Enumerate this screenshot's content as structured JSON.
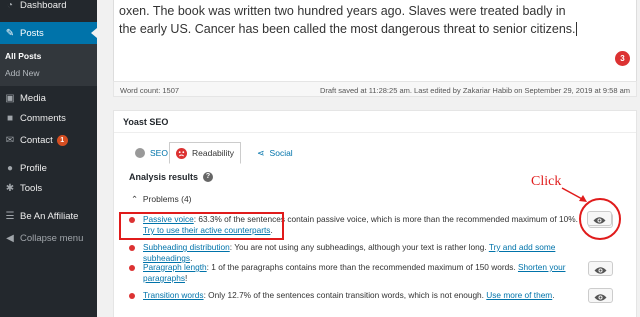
{
  "sidebar": {
    "dashboard": "Dashboard",
    "posts": "Posts",
    "all_posts": "All Posts",
    "add_new": "Add New",
    "media": "Media",
    "comments": "Comments",
    "contact": "Contact",
    "contact_badge": "1",
    "profile": "Profile",
    "tools": "Tools",
    "be_affiliate": "Be An Affiliate",
    "collapse": "Collapse menu"
  },
  "editor": {
    "text": "oxen. The book was written two hundred years ago. Slaves were treated badly in the early US. Cancer has been called the most dangerous threat to senior citizens.",
    "error_count": "3",
    "word_count": "Word count: 1507",
    "draft_info": "Draft saved at 11:28:25 am. Last edited by Zakariar Habib on September 29, 2019 at 9:58 am"
  },
  "yoast": {
    "title": "Yoast SEO",
    "tabs": [
      "SEO",
      "Readability",
      "Social"
    ],
    "analysis_label": "Analysis results",
    "problems_label": "Problems (4)",
    "results": [
      {
        "link": "Passive voice",
        "text": ": 63.3% of the sentences contain passive voice, which is more than the recommended maximum of 10%. ",
        "fix": "Try to use their active counterparts",
        "end": "."
      },
      {
        "link": "Subheading distribution",
        "text": ": You are not using any subheadings, although your text is rather long. ",
        "fix": "Try and add some subheadings",
        "end": "."
      },
      {
        "link": "Paragraph length",
        "text": ": 1 of the paragraphs contains more than the recommended maximum of 150 words. ",
        "fix": "Shorten your paragraphs",
        "end": "!"
      },
      {
        "link": "Transition words",
        "text": ": Only 12.7% of the sentences contain transition words, which is not enough. ",
        "fix": "Use more of them",
        "end": "."
      }
    ]
  },
  "annotation": {
    "click": "Click"
  },
  "colors": {
    "accent": "#0073aa",
    "error": "#dc3232",
    "annotation_red": "#e01b1b",
    "sidebar_bg": "#23282d"
  }
}
